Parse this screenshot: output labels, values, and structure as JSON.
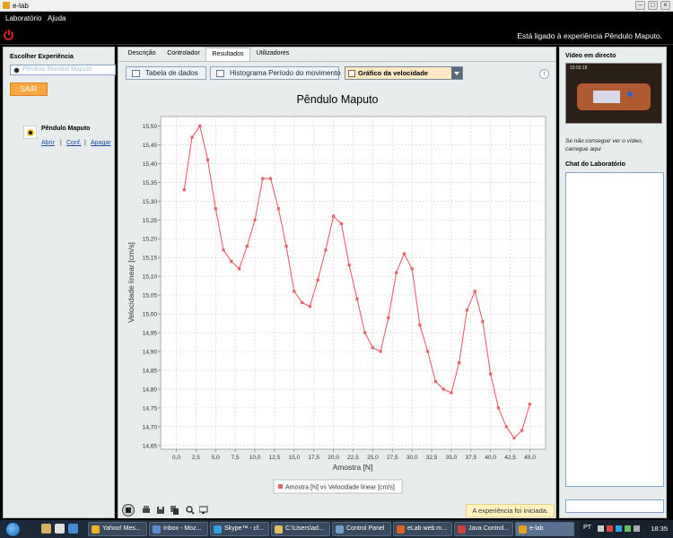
{
  "window": {
    "title": "e-lab"
  },
  "menu": {
    "items": [
      "Laboratório",
      "Ajuda"
    ]
  },
  "status": {
    "connected_message": "Está ligado à experiência Pêndulo Maputo."
  },
  "sidebar": {
    "title": "Escolher Experiência",
    "search_placeholder": "Pêndulo Mundial Maputo",
    "exit_label": "SAIR",
    "experiment": {
      "name": "Pêndulo Maputo",
      "links": [
        "Abrir",
        "Conf.",
        "Apagar"
      ]
    }
  },
  "tabs": [
    {
      "label": "Descrição",
      "active": false
    },
    {
      "label": "Controlador",
      "active": false
    },
    {
      "label": "Resultados",
      "active": true
    },
    {
      "label": "Utilizadores",
      "active": false
    }
  ],
  "toolbar": {
    "data_table": "Tabela de dados",
    "histogram": "Histograma Período do movimento",
    "view_selector": "Gráfico da velocidade",
    "info_icon": "i"
  },
  "chart_data": {
    "type": "line",
    "title": "Pêndulo Maputo",
    "xlabel": "Amostra [N]",
    "ylabel": "Velocidade linear [cm/s]",
    "xlim": [
      -2,
      47
    ],
    "ylim": [
      14.64,
      15.525
    ],
    "xticks": [
      "0,0",
      "2,5",
      "5,0",
      "7,5",
      "10,0",
      "12,5",
      "15,0",
      "17,5",
      "20,0",
      "22,5",
      "25,0",
      "27,5",
      "30,0",
      "32,5",
      "35,0",
      "37,5",
      "40,0",
      "42,5",
      "45,0"
    ],
    "yticks": [
      "14,65",
      "14,70",
      "14,75",
      "14,80",
      "14,85",
      "14,90",
      "14,95",
      "15,00",
      "15,05",
      "15,10",
      "15,15",
      "15,20",
      "15,25",
      "15,30",
      "15,35",
      "15,40",
      "15,45",
      "15,50"
    ],
    "grid": true,
    "legend_position": "bottom",
    "color": "#e8606a",
    "series": [
      {
        "name": "Amostra [N] vs Velocidade linear [cm/s]",
        "x": [
          1,
          2,
          3,
          4,
          5,
          6,
          7,
          8,
          9,
          10,
          11,
          12,
          13,
          14,
          15,
          16,
          17,
          18,
          19,
          20,
          21,
          22,
          23,
          24,
          25,
          26,
          27,
          28,
          29,
          30,
          31,
          32,
          33,
          34,
          35,
          36,
          37,
          38,
          39,
          40,
          41,
          42,
          43,
          44,
          45
        ],
        "y": [
          15.33,
          15.47,
          15.5,
          15.41,
          15.28,
          15.17,
          15.14,
          15.12,
          15.18,
          15.25,
          15.36,
          15.36,
          15.28,
          15.18,
          15.06,
          15.03,
          15.02,
          15.09,
          15.17,
          15.26,
          15.24,
          15.13,
          15.04,
          14.95,
          14.91,
          14.9,
          14.99,
          15.11,
          15.16,
          15.12,
          14.97,
          14.9,
          14.82,
          14.8,
          14.79,
          14.87,
          15.01,
          15.06,
          14.98,
          14.84,
          14.75,
          14.7,
          14.67,
          14.69,
          14.76
        ]
      }
    ]
  },
  "bottom": {
    "experiment_status": "A experiência foi iniciada."
  },
  "right": {
    "video_title": "Vídeo em directo",
    "video_timestamp": "15:55:18",
    "video_note": "Se não conseguir ver o vídeo, carregue aqui",
    "chat_title": "Chat do Laboratório"
  },
  "taskbar": {
    "tasks": [
      "Yahoo! Mes...",
      "Inbox - Moz...",
      "Skype™ - cf...",
      "C:\\Users\\ad...",
      "Control Panel",
      "eLab web m...",
      "Java Control...",
      "e-lab"
    ],
    "lang": "PT",
    "clock": "18:35"
  }
}
